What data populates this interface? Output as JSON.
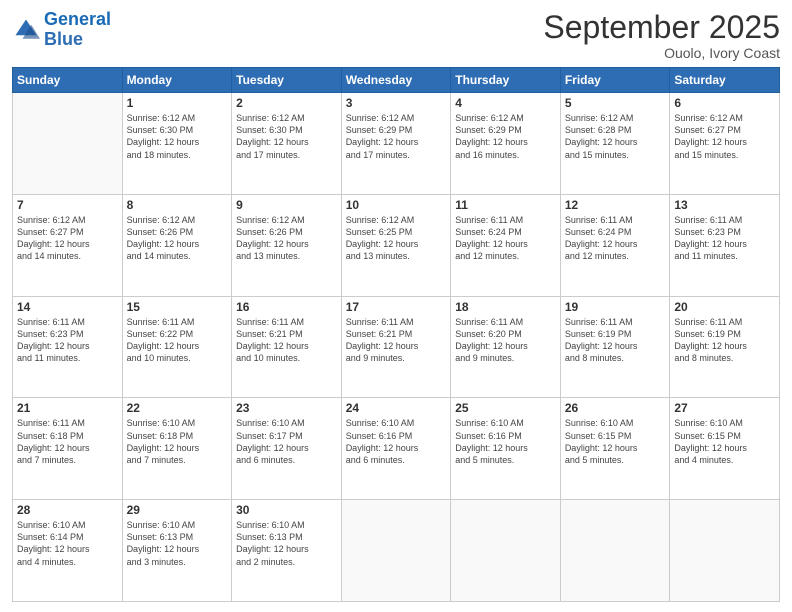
{
  "logo": {
    "line1": "General",
    "line2": "Blue"
  },
  "title": "September 2025",
  "subtitle": "Ouolo, Ivory Coast",
  "days_header": [
    "Sunday",
    "Monday",
    "Tuesday",
    "Wednesday",
    "Thursday",
    "Friday",
    "Saturday"
  ],
  "weeks": [
    [
      {
        "num": "",
        "info": ""
      },
      {
        "num": "1",
        "info": "Sunrise: 6:12 AM\nSunset: 6:30 PM\nDaylight: 12 hours\nand 18 minutes."
      },
      {
        "num": "2",
        "info": "Sunrise: 6:12 AM\nSunset: 6:30 PM\nDaylight: 12 hours\nand 17 minutes."
      },
      {
        "num": "3",
        "info": "Sunrise: 6:12 AM\nSunset: 6:29 PM\nDaylight: 12 hours\nand 17 minutes."
      },
      {
        "num": "4",
        "info": "Sunrise: 6:12 AM\nSunset: 6:29 PM\nDaylight: 12 hours\nand 16 minutes."
      },
      {
        "num": "5",
        "info": "Sunrise: 6:12 AM\nSunset: 6:28 PM\nDaylight: 12 hours\nand 15 minutes."
      },
      {
        "num": "6",
        "info": "Sunrise: 6:12 AM\nSunset: 6:27 PM\nDaylight: 12 hours\nand 15 minutes."
      }
    ],
    [
      {
        "num": "7",
        "info": "Sunrise: 6:12 AM\nSunset: 6:27 PM\nDaylight: 12 hours\nand 14 minutes."
      },
      {
        "num": "8",
        "info": "Sunrise: 6:12 AM\nSunset: 6:26 PM\nDaylight: 12 hours\nand 14 minutes."
      },
      {
        "num": "9",
        "info": "Sunrise: 6:12 AM\nSunset: 6:26 PM\nDaylight: 12 hours\nand 13 minutes."
      },
      {
        "num": "10",
        "info": "Sunrise: 6:12 AM\nSunset: 6:25 PM\nDaylight: 12 hours\nand 13 minutes."
      },
      {
        "num": "11",
        "info": "Sunrise: 6:11 AM\nSunset: 6:24 PM\nDaylight: 12 hours\nand 12 minutes."
      },
      {
        "num": "12",
        "info": "Sunrise: 6:11 AM\nSunset: 6:24 PM\nDaylight: 12 hours\nand 12 minutes."
      },
      {
        "num": "13",
        "info": "Sunrise: 6:11 AM\nSunset: 6:23 PM\nDaylight: 12 hours\nand 11 minutes."
      }
    ],
    [
      {
        "num": "14",
        "info": "Sunrise: 6:11 AM\nSunset: 6:23 PM\nDaylight: 12 hours\nand 11 minutes."
      },
      {
        "num": "15",
        "info": "Sunrise: 6:11 AM\nSunset: 6:22 PM\nDaylight: 12 hours\nand 10 minutes."
      },
      {
        "num": "16",
        "info": "Sunrise: 6:11 AM\nSunset: 6:21 PM\nDaylight: 12 hours\nand 10 minutes."
      },
      {
        "num": "17",
        "info": "Sunrise: 6:11 AM\nSunset: 6:21 PM\nDaylight: 12 hours\nand 9 minutes."
      },
      {
        "num": "18",
        "info": "Sunrise: 6:11 AM\nSunset: 6:20 PM\nDaylight: 12 hours\nand 9 minutes."
      },
      {
        "num": "19",
        "info": "Sunrise: 6:11 AM\nSunset: 6:19 PM\nDaylight: 12 hours\nand 8 minutes."
      },
      {
        "num": "20",
        "info": "Sunrise: 6:11 AM\nSunset: 6:19 PM\nDaylight: 12 hours\nand 8 minutes."
      }
    ],
    [
      {
        "num": "21",
        "info": "Sunrise: 6:11 AM\nSunset: 6:18 PM\nDaylight: 12 hours\nand 7 minutes."
      },
      {
        "num": "22",
        "info": "Sunrise: 6:10 AM\nSunset: 6:18 PM\nDaylight: 12 hours\nand 7 minutes."
      },
      {
        "num": "23",
        "info": "Sunrise: 6:10 AM\nSunset: 6:17 PM\nDaylight: 12 hours\nand 6 minutes."
      },
      {
        "num": "24",
        "info": "Sunrise: 6:10 AM\nSunset: 6:16 PM\nDaylight: 12 hours\nand 6 minutes."
      },
      {
        "num": "25",
        "info": "Sunrise: 6:10 AM\nSunset: 6:16 PM\nDaylight: 12 hours\nand 5 minutes."
      },
      {
        "num": "26",
        "info": "Sunrise: 6:10 AM\nSunset: 6:15 PM\nDaylight: 12 hours\nand 5 minutes."
      },
      {
        "num": "27",
        "info": "Sunrise: 6:10 AM\nSunset: 6:15 PM\nDaylight: 12 hours\nand 4 minutes."
      }
    ],
    [
      {
        "num": "28",
        "info": "Sunrise: 6:10 AM\nSunset: 6:14 PM\nDaylight: 12 hours\nand 4 minutes."
      },
      {
        "num": "29",
        "info": "Sunrise: 6:10 AM\nSunset: 6:13 PM\nDaylight: 12 hours\nand 3 minutes."
      },
      {
        "num": "30",
        "info": "Sunrise: 6:10 AM\nSunset: 6:13 PM\nDaylight: 12 hours\nand 2 minutes."
      },
      {
        "num": "",
        "info": ""
      },
      {
        "num": "",
        "info": ""
      },
      {
        "num": "",
        "info": ""
      },
      {
        "num": "",
        "info": ""
      }
    ]
  ]
}
